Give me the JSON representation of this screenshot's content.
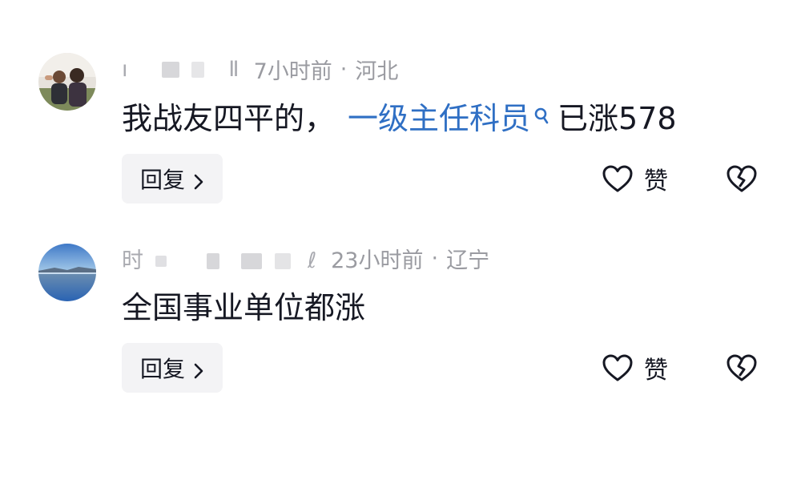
{
  "comments": [
    {
      "username_first": "ı",
      "username_last": "Ⅱ",
      "time": "7小时前",
      "separator": "·",
      "location": "河北",
      "text_before": "我战友四平的，",
      "link_text": "一级主任科员",
      "text_after": "已涨578",
      "reply_label": "回复",
      "like_label": "赞",
      "avatar_icon": "avatar-photo-people",
      "link_color": "#2f6fc4"
    },
    {
      "username_first": "时",
      "username_last": "ℓ",
      "time": "23小时前",
      "separator": "·",
      "location": "辽宁",
      "text_before": "全国事业单位都涨",
      "reply_label": "回复",
      "like_label": "赞",
      "avatar_icon": "avatar-photo-lake"
    }
  ],
  "icons": {
    "like": "heart-outline-icon",
    "dislike": "broken-heart-icon",
    "reply_chevron": "chevron-right-icon",
    "link_search": "search-icon"
  },
  "colors": {
    "text": "#161823",
    "meta": "#9a9ba1",
    "link": "#2f6fc4",
    "reply_bg": "#f3f3f5"
  }
}
